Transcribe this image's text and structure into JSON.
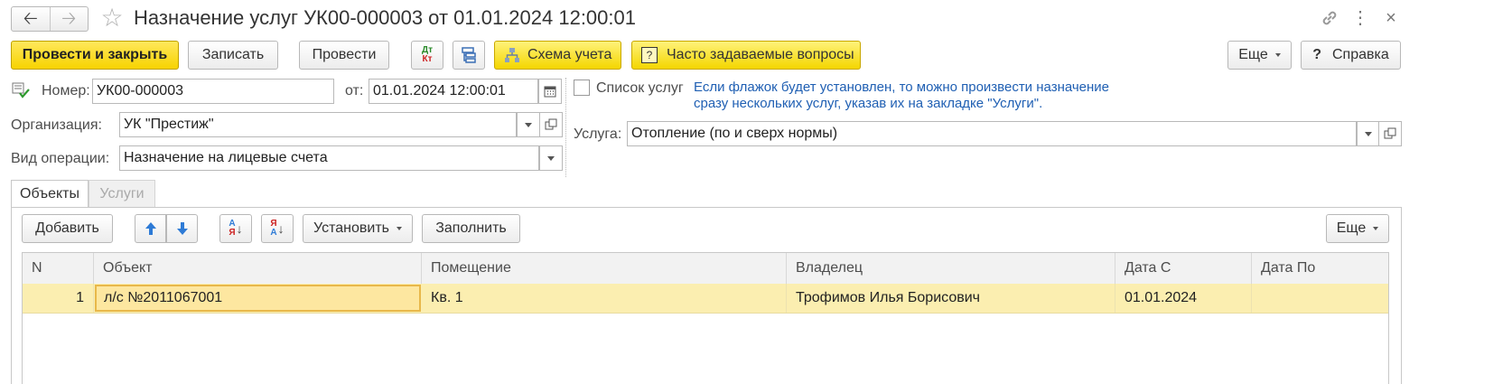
{
  "window": {
    "title": "Назначение услуг УК00-000003 от 01.01.2024 12:00:01"
  },
  "toolbar": {
    "post_close": "Провести и закрыть",
    "save": "Записать",
    "post": "Провести",
    "dtkt_top": "Дт",
    "dtkt_bottom": "Кт",
    "scheme": "Схема учета",
    "faq": "Часто задаваемые вопросы",
    "more": "Еще",
    "help_mark": "?",
    "help": "Справка"
  },
  "form": {
    "number_label": "Номер:",
    "number_value": "УК00-000003",
    "date_label": "от:",
    "date_value": "01.01.2024 12:00:01",
    "org_label": "Организация:",
    "org_value": "УК \"Престиж\"",
    "op_label": "Вид операции:",
    "op_value": "Назначение на лицевые счета",
    "service_list_label": "Список услуг",
    "service_list_checked": false,
    "hint_line1": "Если флажок будет установлен, то можно произвести назначение",
    "hint_line2": "сразу нескольких услуг, указав их на закладке \"Услуги\".",
    "service_label": "Услуга:",
    "service_value": "Отопление (по и сверх нормы)"
  },
  "tabs": [
    {
      "label": "Объекты",
      "active": true
    },
    {
      "label": "Услуги",
      "active": false
    }
  ],
  "table_toolbar": {
    "add": "Добавить",
    "sort_az_top": "А",
    "sort_az_bottom": "Я",
    "sort_za_top": "Я",
    "sort_za_bottom": "А",
    "set": "Установить",
    "fill": "Заполнить",
    "more": "Еще"
  },
  "table": {
    "columns": [
      "N",
      "Объект",
      "Помещение",
      "Владелец",
      "Дата С",
      "Дата По"
    ],
    "rows": [
      {
        "n": "1",
        "object": "л/с №2011067001",
        "room": "Кв. 1",
        "owner": "Трофимов Илья Борисович",
        "date_from": "01.01.2024",
        "date_to": ""
      }
    ]
  },
  "colors": {
    "accent_yellow": "#f4d600",
    "selected_row": "#fbeeb0",
    "hint_blue": "#1f5fb3",
    "arrow_blue": "#2e7bd6"
  }
}
